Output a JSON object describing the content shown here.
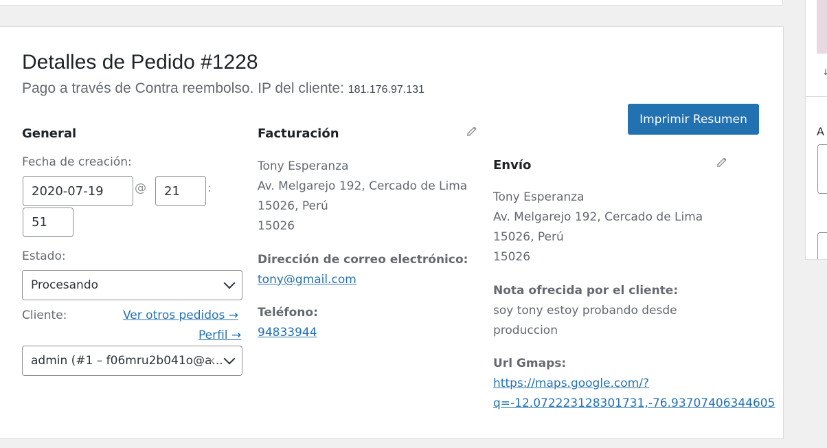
{
  "order": {
    "title": "Detalles de Pedido #1228",
    "payment_text": "Pago a través de Contra reembolso. IP del cliente:",
    "ip": "181.176.97.131",
    "print_button": "Imprimir Resumen"
  },
  "general": {
    "heading": "General",
    "date_label": "Fecha de creación:",
    "date_value": "2020-07-19",
    "at_sep": "@",
    "hour_value": "21",
    "colon_sep": ":",
    "minute_value": "51",
    "status_label": "Estado:",
    "status_value": "Procesando",
    "customer_label": "Cliente:",
    "other_orders_link": "Ver otros pedidos →",
    "profile_link": "Perfil →",
    "customer_value": "admin (#1 – f06mru2b041o@a...",
    "clear_symbol": "×"
  },
  "billing": {
    "heading": "Facturación",
    "address": [
      "Tony Esperanza",
      "Av. Melgarejo 192, Cercado de Lima",
      "15026, Perú",
      "15026"
    ],
    "email_label": "Dirección de correo electrónico:",
    "email": "tony@gmail.com",
    "phone_label": "Teléfono:",
    "phone": "94833944"
  },
  "shipping": {
    "heading": "Envío",
    "address": [
      "Tony Esperanza",
      "Av. Melgarejo 192, Cercado de Lima",
      "15026, Perú",
      "15026"
    ],
    "note_label": "Nota ofrecida por el cliente:",
    "note": [
      "soy tony estoy probando desde",
      "produccion"
    ],
    "gmaps_label": "Url Gmaps:",
    "gmaps_url": [
      "https://maps.google.com/?",
      "q=-12.072223128301731,-76.93707406344605"
    ]
  },
  "sidebar": {
    "label_fragment": "A",
    "arrow": "↓"
  },
  "colors": {
    "primary": "#2271b1",
    "link": "#2271b1",
    "text_muted": "#646970"
  },
  "icons": {
    "edit_billing": "pencil-icon",
    "edit_shipping": "pencil-icon",
    "status_dropdown": "chevron-down-icon"
  }
}
